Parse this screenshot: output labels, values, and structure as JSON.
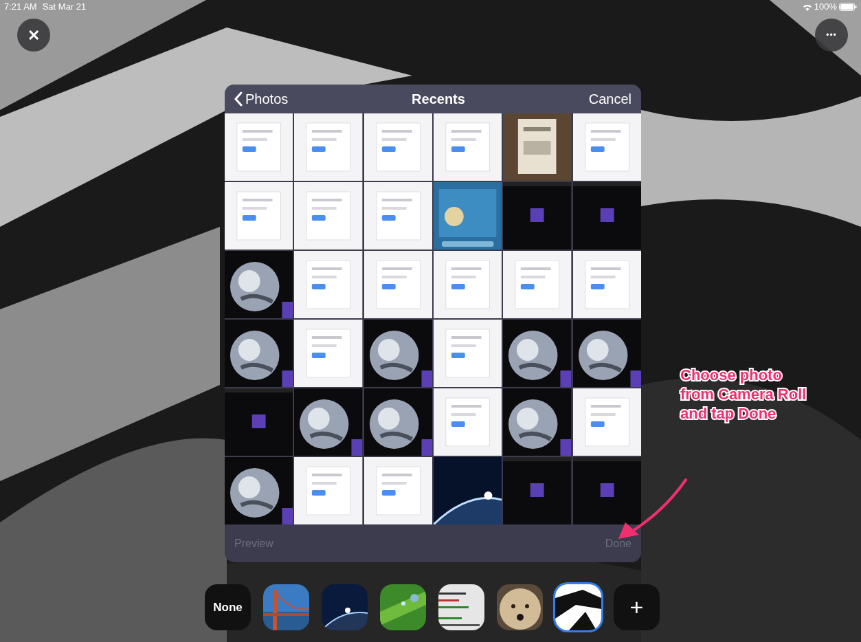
{
  "status_bar": {
    "time": "7:21 AM",
    "date": "Sat Mar 21",
    "battery": "100%"
  },
  "top_buttons": [
    {
      "kind": "close",
      "label": "✕"
    },
    {
      "kind": "more",
      "label": "•••"
    }
  ],
  "picker": {
    "back": "Photos",
    "title": "Recents",
    "cancel": "Cancel",
    "photos": [
      {
        "kind": "picture"
      },
      {
        "kind": "picture"
      },
      {
        "kind": "picture"
      },
      {
        "kind": "picture"
      },
      {
        "kind": "picture"
      },
      {
        "kind": "picture"
      },
      {
        "kind": "picture"
      },
      {
        "kind": "picture"
      },
      {
        "kind": "picture"
      },
      {
        "kind": "picture"
      },
      {
        "kind": "picture"
      },
      {
        "kind": "picture"
      },
      {
        "kind": "picture"
      },
      {
        "kind": "picture"
      },
      {
        "kind": "picture"
      },
      {
        "kind": "picture"
      },
      {
        "kind": "picture"
      },
      {
        "kind": "picture"
      },
      {
        "kind": "picture"
      },
      {
        "kind": "picture"
      },
      {
        "kind": "picture"
      },
      {
        "kind": "picture"
      },
      {
        "kind": "picture"
      },
      {
        "kind": "picture"
      },
      {
        "kind": "picture"
      },
      {
        "kind": "picture"
      },
      {
        "kind": "picture"
      },
      {
        "kind": "picture"
      },
      {
        "kind": "picture"
      },
      {
        "kind": "picture"
      },
      {
        "kind": "picture"
      },
      {
        "kind": "picture"
      },
      {
        "kind": "picture"
      },
      {
        "kind": "picture"
      },
      {
        "kind": "picture"
      },
      {
        "kind": "picture"
      }
    ],
    "footer": [
      {
        "label": "Preview",
        "disabled": true
      },
      {
        "label": "Done",
        "disabled": true
      }
    ]
  },
  "backgrounds": [
    {
      "kind": "none",
      "label": "None",
      "selected": false
    },
    {
      "kind": "picture",
      "selected": false
    },
    {
      "kind": "picture",
      "selected": false
    },
    {
      "kind": "picture",
      "selected": false
    },
    {
      "kind": "picture",
      "selected": false
    },
    {
      "kind": "picture",
      "selected": false
    },
    {
      "kind": "picture",
      "selected": true
    },
    {
      "kind": "add",
      "label": "+",
      "selected": false
    }
  ],
  "annotation": {
    "text": "Choose photo from Camera Roll and tap Done"
  }
}
